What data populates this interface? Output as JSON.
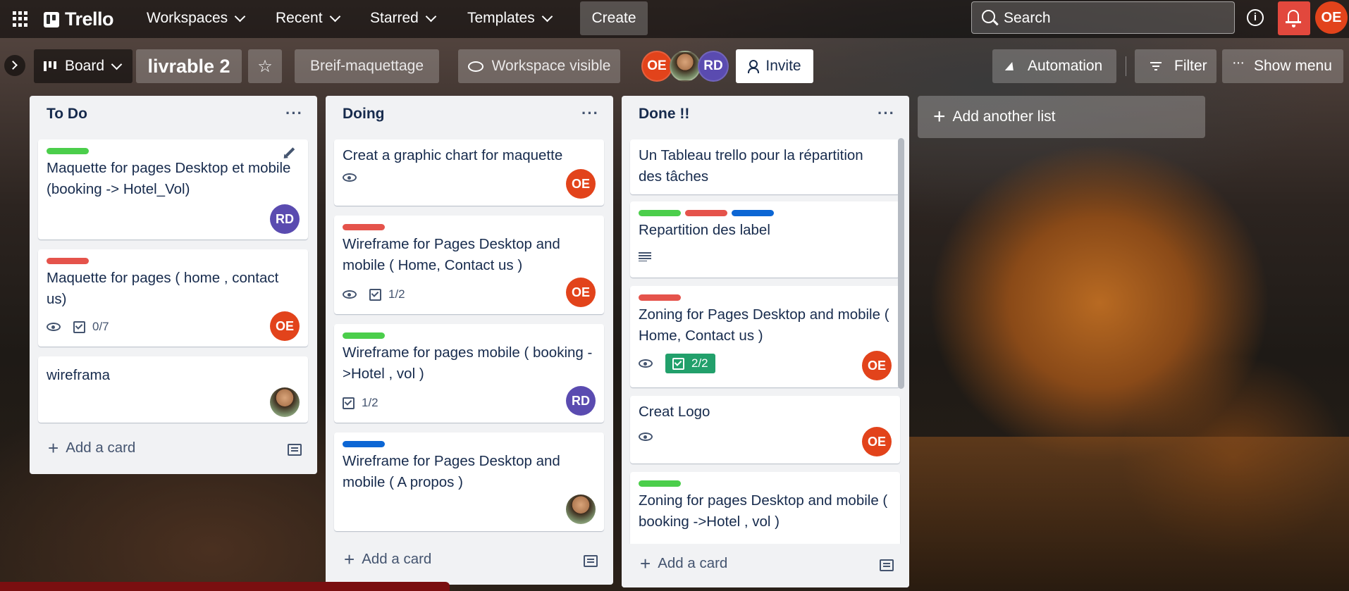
{
  "topbar": {
    "logo": "Trello",
    "nav": [
      "Workspaces",
      "Recent",
      "Starred",
      "Templates"
    ],
    "create": "Create",
    "search_placeholder": "Search",
    "user_initials": "OE"
  },
  "board_header": {
    "view": "Board",
    "title": "livrable 2",
    "workspace": "Breif-maquettage",
    "visibility": "Workspace visible",
    "members": [
      {
        "type": "initials",
        "text": "OE",
        "color": "#e2431b"
      },
      {
        "type": "photo",
        "text": ""
      },
      {
        "type": "initials",
        "text": "RD",
        "color": "#5a4bb0"
      }
    ],
    "invite": "Invite",
    "automation": "Automation",
    "filter": "Filter",
    "show_menu": "Show menu"
  },
  "lists": [
    {
      "title": "To Do",
      "add_card": "Add a card",
      "cards": [
        {
          "labels": [
            "green"
          ],
          "title": "Maquette for pages Desktop et mobile (booking -> Hotel_Vol)",
          "avatar": "RD",
          "avatar_color": "#5a4bb0"
        },
        {
          "labels": [
            "red"
          ],
          "title": "Maquette for pages ( home , contact us)",
          "watch": true,
          "checklist": "0/7",
          "avatar": "OE",
          "avatar_color": "#e2431b"
        },
        {
          "labels": [],
          "title": "wireframa",
          "avatar": "photo"
        }
      ]
    },
    {
      "title": "Doing",
      "add_card": "Add a card",
      "cards": [
        {
          "labels": [],
          "title": "Creat a graphic chart for maquette",
          "watch": true,
          "avatar": "OE"
        },
        {
          "labels": [
            "red"
          ],
          "title": "Wireframe for Pages Desktop and mobile ( Home, Contact us )",
          "watch": true,
          "checklist": "1/2",
          "avatar": "OE"
        },
        {
          "labels": [
            "green"
          ],
          "title": "Wireframe for pages mobile ( booking ->Hotel , vol )",
          "checklist": "1/2",
          "avatar": "RD"
        },
        {
          "labels": [
            "blue"
          ],
          "title": "Wireframe for Pages Desktop and mobile ( A propos )",
          "avatar": "photo"
        }
      ]
    },
    {
      "title": "Done !!",
      "add_card": "Add a card",
      "cards": [
        {
          "labels": [],
          "title": "Un Tableau trello pour la répartition des tâches"
        },
        {
          "labels": [
            "green",
            "red",
            "blue"
          ],
          "title": "Repartition des label",
          "description": true
        },
        {
          "labels": [
            "red"
          ],
          "title": "Zoning for Pages Desktop and mobile ( Home, Contact us )",
          "watch": true,
          "checklist": "2/2",
          "avatar": "OE"
        },
        {
          "labels": [],
          "title": "Creat Logo",
          "watch": true,
          "avatar": "OE"
        },
        {
          "labels": [
            "green"
          ],
          "title": "Zoning for pages Desktop and mobile ( booking ->Hotel , vol )"
        }
      ]
    }
  ],
  "add_another_list": "Add another list",
  "list_menu_glyph": "···",
  "colors": {
    "green": "#4bce4b",
    "red": "#e5534b",
    "blue": "#0c66d4",
    "oe": "#e2431b",
    "rd": "#5a4bb0"
  }
}
